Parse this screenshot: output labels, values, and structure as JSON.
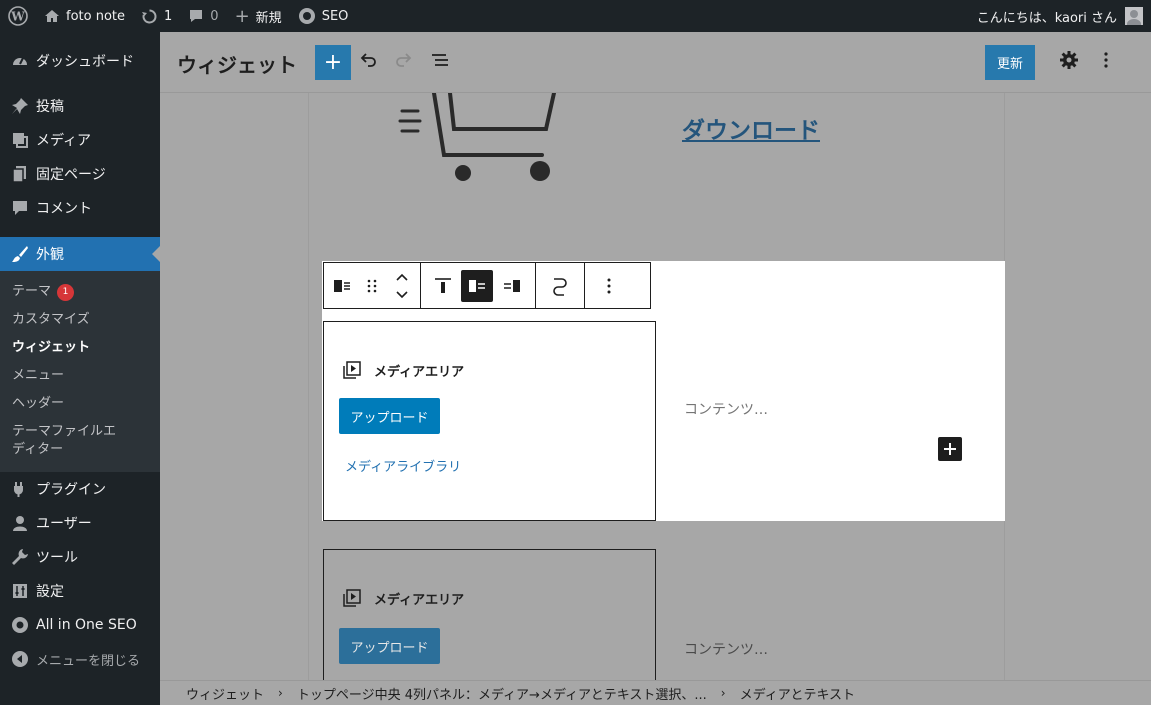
{
  "adminbar": {
    "site_name": "foto note",
    "updates_count": "1",
    "comments_count": "0",
    "new_label": "新規",
    "seo_label": "SEO",
    "greeting": "こんにちは、kaori さん"
  },
  "sidebar": {
    "items_top": [
      {
        "label": "ダッシュボード",
        "icon": "dashboard-icon"
      },
      {
        "label": "投稿",
        "icon": "pin-icon"
      },
      {
        "label": "メディア",
        "icon": "media-icon"
      },
      {
        "label": "固定ページ",
        "icon": "page-icon"
      },
      {
        "label": "コメント",
        "icon": "comment-icon"
      },
      {
        "label": "外観",
        "icon": "brush-icon"
      }
    ],
    "submenu": [
      {
        "label": "テーマ",
        "badge": "1"
      },
      {
        "label": "カスタマイズ"
      },
      {
        "label": "ウィジェット"
      },
      {
        "label": "メニュー"
      },
      {
        "label": "ヘッダー"
      },
      {
        "label": "テーマファイルエディター"
      }
    ],
    "items_bottom": [
      {
        "label": "プラグイン",
        "icon": "plugin-icon"
      },
      {
        "label": "ユーザー",
        "icon": "user-icon"
      },
      {
        "label": "ツール",
        "icon": "wrench-icon"
      },
      {
        "label": "設定",
        "icon": "settings-icon"
      },
      {
        "label": "All in One SEO",
        "icon": "seo-icon"
      }
    ],
    "collapse_label": "メニューを閉じる"
  },
  "header": {
    "title": "ウィジェット",
    "update_label": "更新"
  },
  "canvas": {
    "download_link": "ダウンロード",
    "block1": {
      "media_title": "メディアエリア",
      "upload_label": "アップロード",
      "library_label": "メディアライブラリ",
      "content_placeholder": "コンテンツ…"
    },
    "block2": {
      "media_title": "メディアエリア",
      "upload_label": "アップロード",
      "content_placeholder": "コンテンツ…"
    }
  },
  "breadcrumb": {
    "items": [
      "ウィジェット",
      "トップページ中央 4列パネル：メディア→メディアとテキスト選択、...",
      "メディアとテキスト"
    ]
  },
  "colors": {
    "admin_dark": "#1d2327",
    "accent": "#2271b1",
    "button_blue": "#007cba",
    "overlay_gray": "#a7a7a7"
  }
}
